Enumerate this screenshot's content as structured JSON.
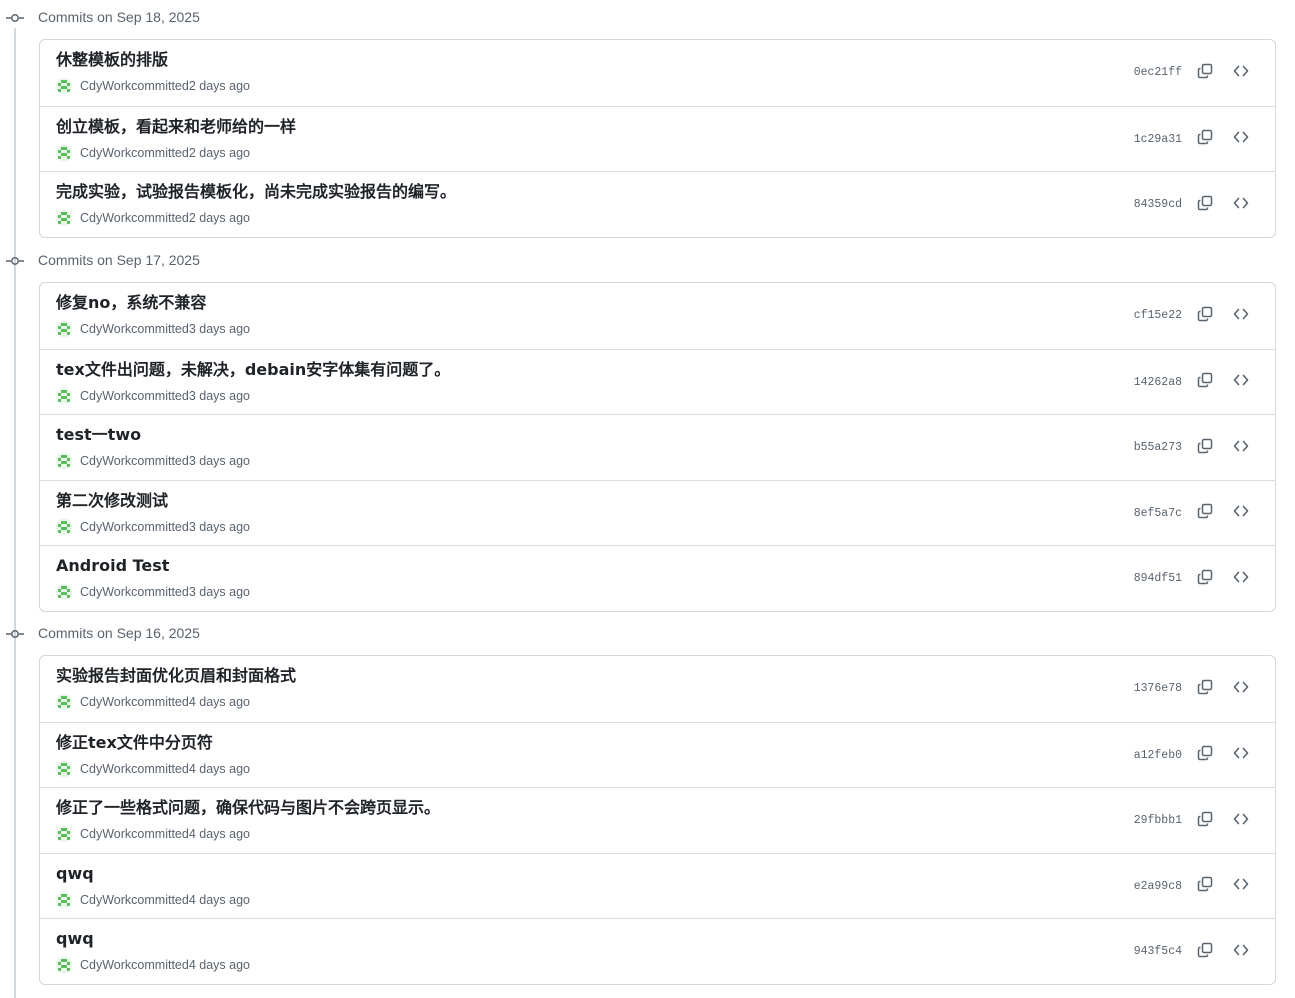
{
  "colors": {
    "border": "#d0d7de",
    "muted": "#59636e",
    "text": "#1f2328",
    "avatar": "#57c05a"
  },
  "icons": {
    "group_marker": "git-commit-icon",
    "copy": "copy-icon",
    "browse": "code-icon",
    "avatar": "identicon-avatar"
  },
  "groups": [
    {
      "title": "Commits on Sep 18, 2025",
      "commits": [
        {
          "message": "休整模板的排版",
          "author": "CdyWork",
          "action": "committed",
          "time": "2 days ago",
          "sha": "0ec21ff"
        },
        {
          "message": "创立模板，看起来和老师给的一样",
          "author": "CdyWork",
          "action": "committed",
          "time": "2 days ago",
          "sha": "1c29a31"
        },
        {
          "message": "完成实验，试验报告模板化，尚未完成实验报告的编写。",
          "author": "CdyWork",
          "action": "committed",
          "time": "2 days ago",
          "sha": "84359cd"
        }
      ]
    },
    {
      "title": "Commits on Sep 17, 2025",
      "commits": [
        {
          "message": "修复no，系统不兼容",
          "author": "CdyWork",
          "action": "committed",
          "time": "3 days ago",
          "sha": "cf15e22"
        },
        {
          "message": "tex文件出问题，未解决，debain安字体集有问题了。",
          "author": "CdyWork",
          "action": "committed",
          "time": "3 days ago",
          "sha": "14262a8"
        },
        {
          "message": "test一two",
          "author": "CdyWork",
          "action": "committed",
          "time": "3 days ago",
          "sha": "b55a273"
        },
        {
          "message": "第二次修改测试",
          "author": "CdyWork",
          "action": "committed",
          "time": "3 days ago",
          "sha": "8ef5a7c"
        },
        {
          "message": "Android Test",
          "author": "CdyWork",
          "action": "committed",
          "time": "3 days ago",
          "sha": "894df51"
        }
      ]
    },
    {
      "title": "Commits on Sep 16, 2025",
      "commits": [
        {
          "message": "实验报告封面优化页眉和封面格式",
          "author": "CdyWork",
          "action": "committed",
          "time": "4 days ago",
          "sha": "1376e78"
        },
        {
          "message": "修正tex文件中分页符",
          "author": "CdyWork",
          "action": "committed",
          "time": "4 days ago",
          "sha": "a12feb0"
        },
        {
          "message": "修正了一些格式问题，确保代码与图片不会跨页显示。",
          "author": "CdyWork",
          "action": "committed",
          "time": "4 days ago",
          "sha": "29fbbb1"
        },
        {
          "message": "qwq",
          "author": "CdyWork",
          "action": "committed",
          "time": "4 days ago",
          "sha": "e2a99c8"
        },
        {
          "message": "qwq",
          "author": "CdyWork",
          "action": "committed",
          "time": "4 days ago",
          "sha": "943f5c4"
        }
      ]
    }
  ]
}
